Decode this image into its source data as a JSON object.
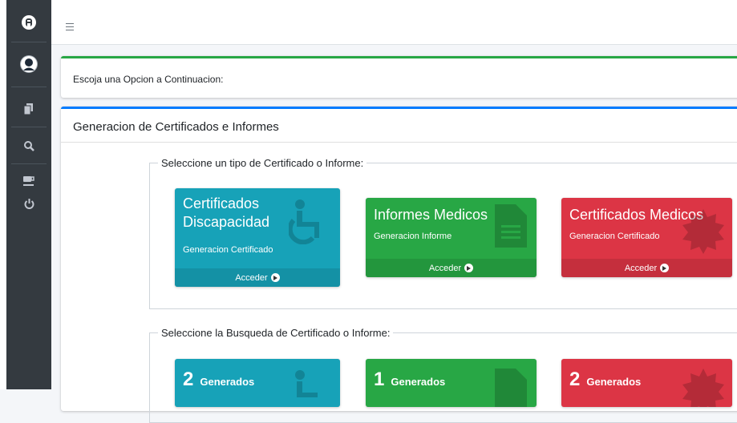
{
  "sidebar": {
    "icons": [
      "logo-icon",
      "user-avatar-icon",
      "documents-icon",
      "search-icon",
      "coffee-icon",
      "power-icon"
    ]
  },
  "topbar": {
    "menu_icon": "hamburger-icon"
  },
  "intro_card": {
    "text": "Escoja una Opcion a Continuacion:"
  },
  "main_card": {
    "title": "Generacion de Certificados e Informes",
    "section1": {
      "legend": "Seleccione un tipo de Certificado o Informe:",
      "boxes": [
        {
          "title": "Certificados Discapacidad",
          "subtitle": "Generacion Certificado",
          "action": "Acceder",
          "color": "#17a2b8",
          "icon": "wheelchair-icon"
        },
        {
          "title": "Informes Medicos",
          "subtitle": "Generacion Informe",
          "action": "Acceder",
          "color": "#28a745",
          "icon": "file-icon"
        },
        {
          "title": "Certificados Medicos",
          "subtitle": "Generacion Certificado",
          "action": "Acceder",
          "color": "#dc3545",
          "icon": "certificate-icon"
        }
      ]
    },
    "section2": {
      "legend": "Seleccione la Busqueda de Certificado o Informe:",
      "boxes": [
        {
          "count": "2",
          "label": "Generados",
          "color": "#17a2b8",
          "icon": "wheelchair-icon"
        },
        {
          "count": "1",
          "label": "Generados",
          "color": "#28a745",
          "icon": "file-icon"
        },
        {
          "count": "2",
          "label": "Generados",
          "color": "#dc3545",
          "icon": "certificate-icon"
        }
      ]
    }
  }
}
